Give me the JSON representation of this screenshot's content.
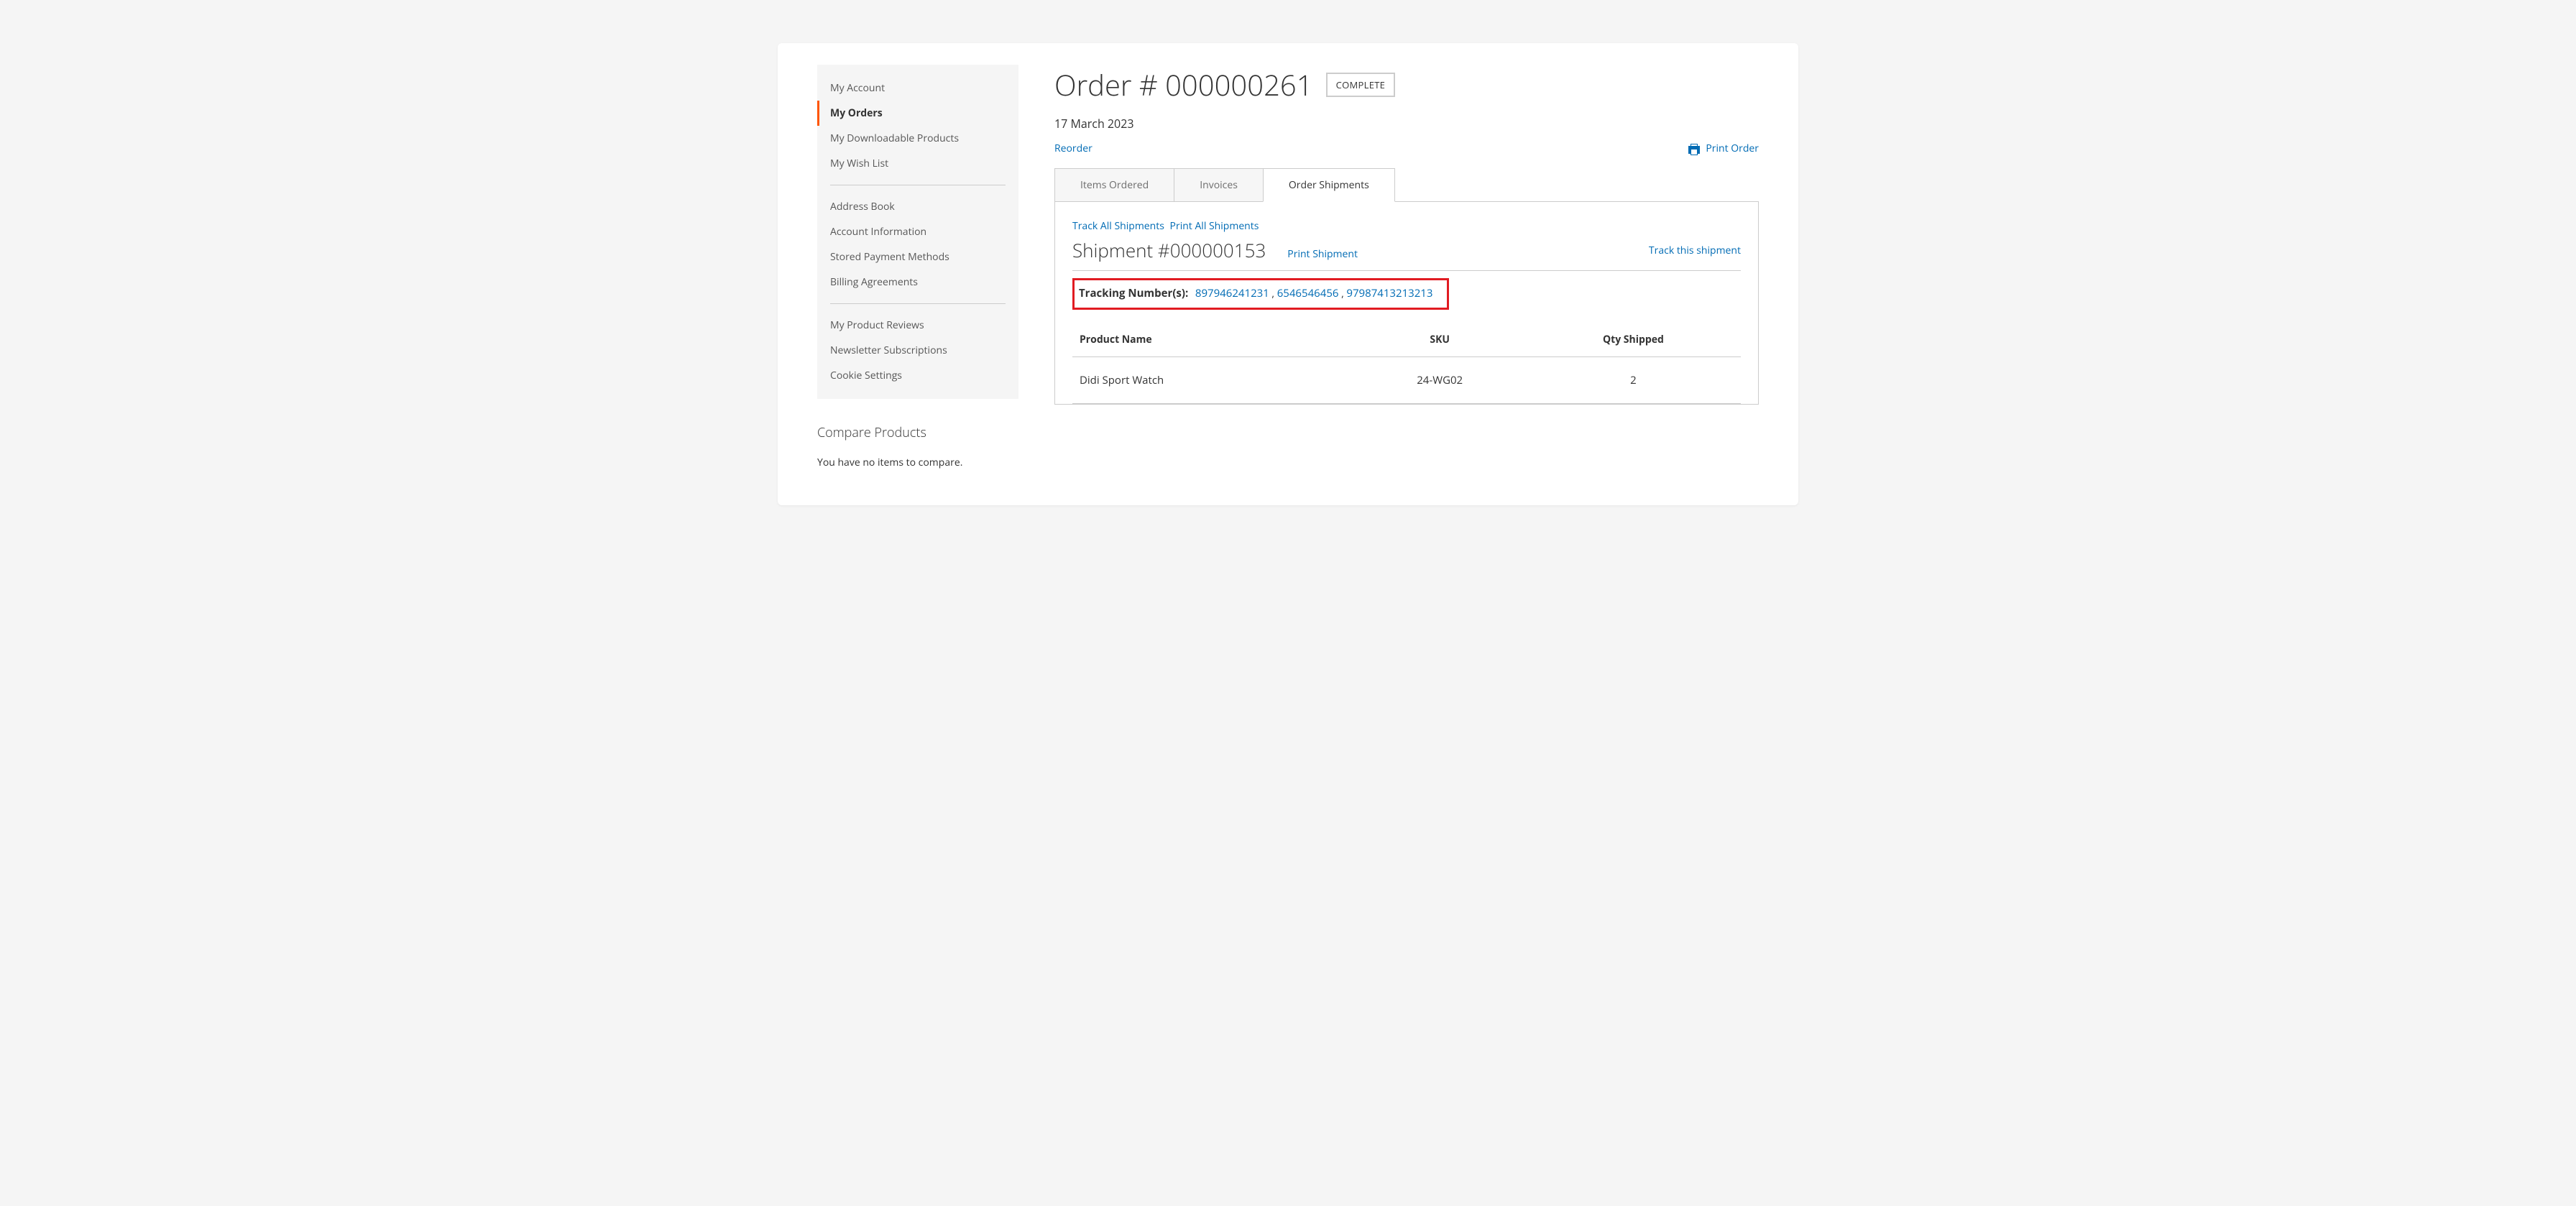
{
  "sidebar": {
    "groups": [
      [
        {
          "label": "My Account",
          "active": false,
          "name": "sidebar-item-my-account"
        },
        {
          "label": "My Orders",
          "active": true,
          "name": "sidebar-item-my-orders"
        },
        {
          "label": "My Downloadable Products",
          "active": false,
          "name": "sidebar-item-my-downloadable-products"
        },
        {
          "label": "My Wish List",
          "active": false,
          "name": "sidebar-item-my-wish-list"
        }
      ],
      [
        {
          "label": "Address Book",
          "active": false,
          "name": "sidebar-item-address-book"
        },
        {
          "label": "Account Information",
          "active": false,
          "name": "sidebar-item-account-information"
        },
        {
          "label": "Stored Payment Methods",
          "active": false,
          "name": "sidebar-item-stored-payment-methods"
        },
        {
          "label": "Billing Agreements",
          "active": false,
          "name": "sidebar-item-billing-agreements"
        }
      ],
      [
        {
          "label": "My Product Reviews",
          "active": false,
          "name": "sidebar-item-my-product-reviews"
        },
        {
          "label": "Newsletter Subscriptions",
          "active": false,
          "name": "sidebar-item-newsletter-subscriptions"
        },
        {
          "label": "Cookie Settings",
          "active": false,
          "name": "sidebar-item-cookie-settings"
        }
      ]
    ]
  },
  "compare": {
    "title": "Compare Products",
    "empty": "You have no items to compare."
  },
  "order": {
    "title": "Order # 000000261",
    "status": "COMPLETE",
    "date": "17 March 2023",
    "reorder": "Reorder",
    "printOrder": "Print Order"
  },
  "tabs": [
    {
      "label": "Items Ordered",
      "active": false,
      "name": "tab-items-ordered"
    },
    {
      "label": "Invoices",
      "active": false,
      "name": "tab-invoices"
    },
    {
      "label": "Order Shipments",
      "active": true,
      "name": "tab-order-shipments"
    }
  ],
  "shipments": {
    "trackAll": "Track All Shipments",
    "printAll": "Print All Shipments",
    "title": "Shipment #000000153",
    "printShipment": "Print Shipment",
    "trackThis": "Track this shipment",
    "trackingLabel": "Tracking Number(s):",
    "trackingNumbers": [
      "897946241231",
      "6546546456",
      "97987413213213"
    ],
    "table": {
      "headers": {
        "product": "Product Name",
        "sku": "SKU",
        "qty": "Qty Shipped"
      },
      "rows": [
        {
          "product": "Didi Sport Watch",
          "sku": "24-WG02",
          "qty": "2"
        }
      ]
    }
  }
}
